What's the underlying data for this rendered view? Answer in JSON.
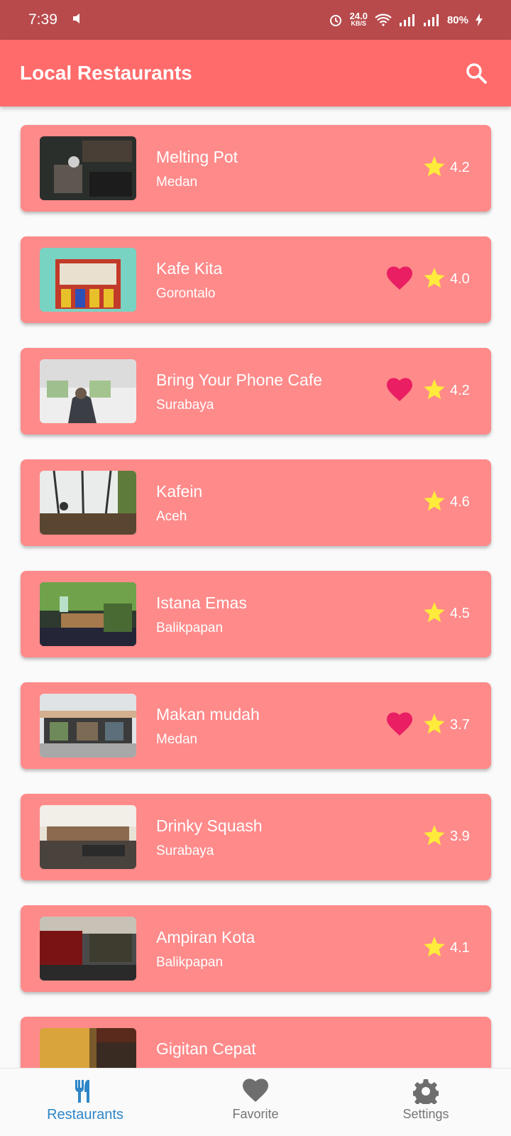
{
  "status_bar": {
    "time": "7:39",
    "speed_top": "24.0",
    "speed_bottom": "KB/S",
    "battery": "80%"
  },
  "app_bar": {
    "title": "Local Restaurants"
  },
  "restaurants": [
    {
      "name": "Melting Pot",
      "city": "Medan",
      "rating": "4.2",
      "favorite": false
    },
    {
      "name": "Kafe Kita",
      "city": "Gorontalo",
      "rating": "4.0",
      "favorite": true
    },
    {
      "name": "Bring Your Phone Cafe",
      "city": "Surabaya",
      "rating": "4.2",
      "favorite": true
    },
    {
      "name": "Kafein",
      "city": "Aceh",
      "rating": "4.6",
      "favorite": false
    },
    {
      "name": "Istana Emas",
      "city": "Balikpapan",
      "rating": "4.5",
      "favorite": false
    },
    {
      "name": "Makan mudah",
      "city": "Medan",
      "rating": "3.7",
      "favorite": true
    },
    {
      "name": "Drinky Squash",
      "city": "Surabaya",
      "rating": "3.9",
      "favorite": false
    },
    {
      "name": "Ampiran Kota",
      "city": "Balikpapan",
      "rating": "4.1",
      "favorite": false
    },
    {
      "name": "Gigitan Cepat",
      "city": "",
      "rating": "",
      "favorite": false
    }
  ],
  "bottom_nav": {
    "restaurants": "Restaurants",
    "favorite": "Favorite",
    "settings": "Settings"
  },
  "colors": {
    "app_bar": "#ff6b6b",
    "card": "#ff8a8a",
    "heart": "#e91e63",
    "star": "#ffeb3b",
    "active_nav": "#2e86c8"
  }
}
